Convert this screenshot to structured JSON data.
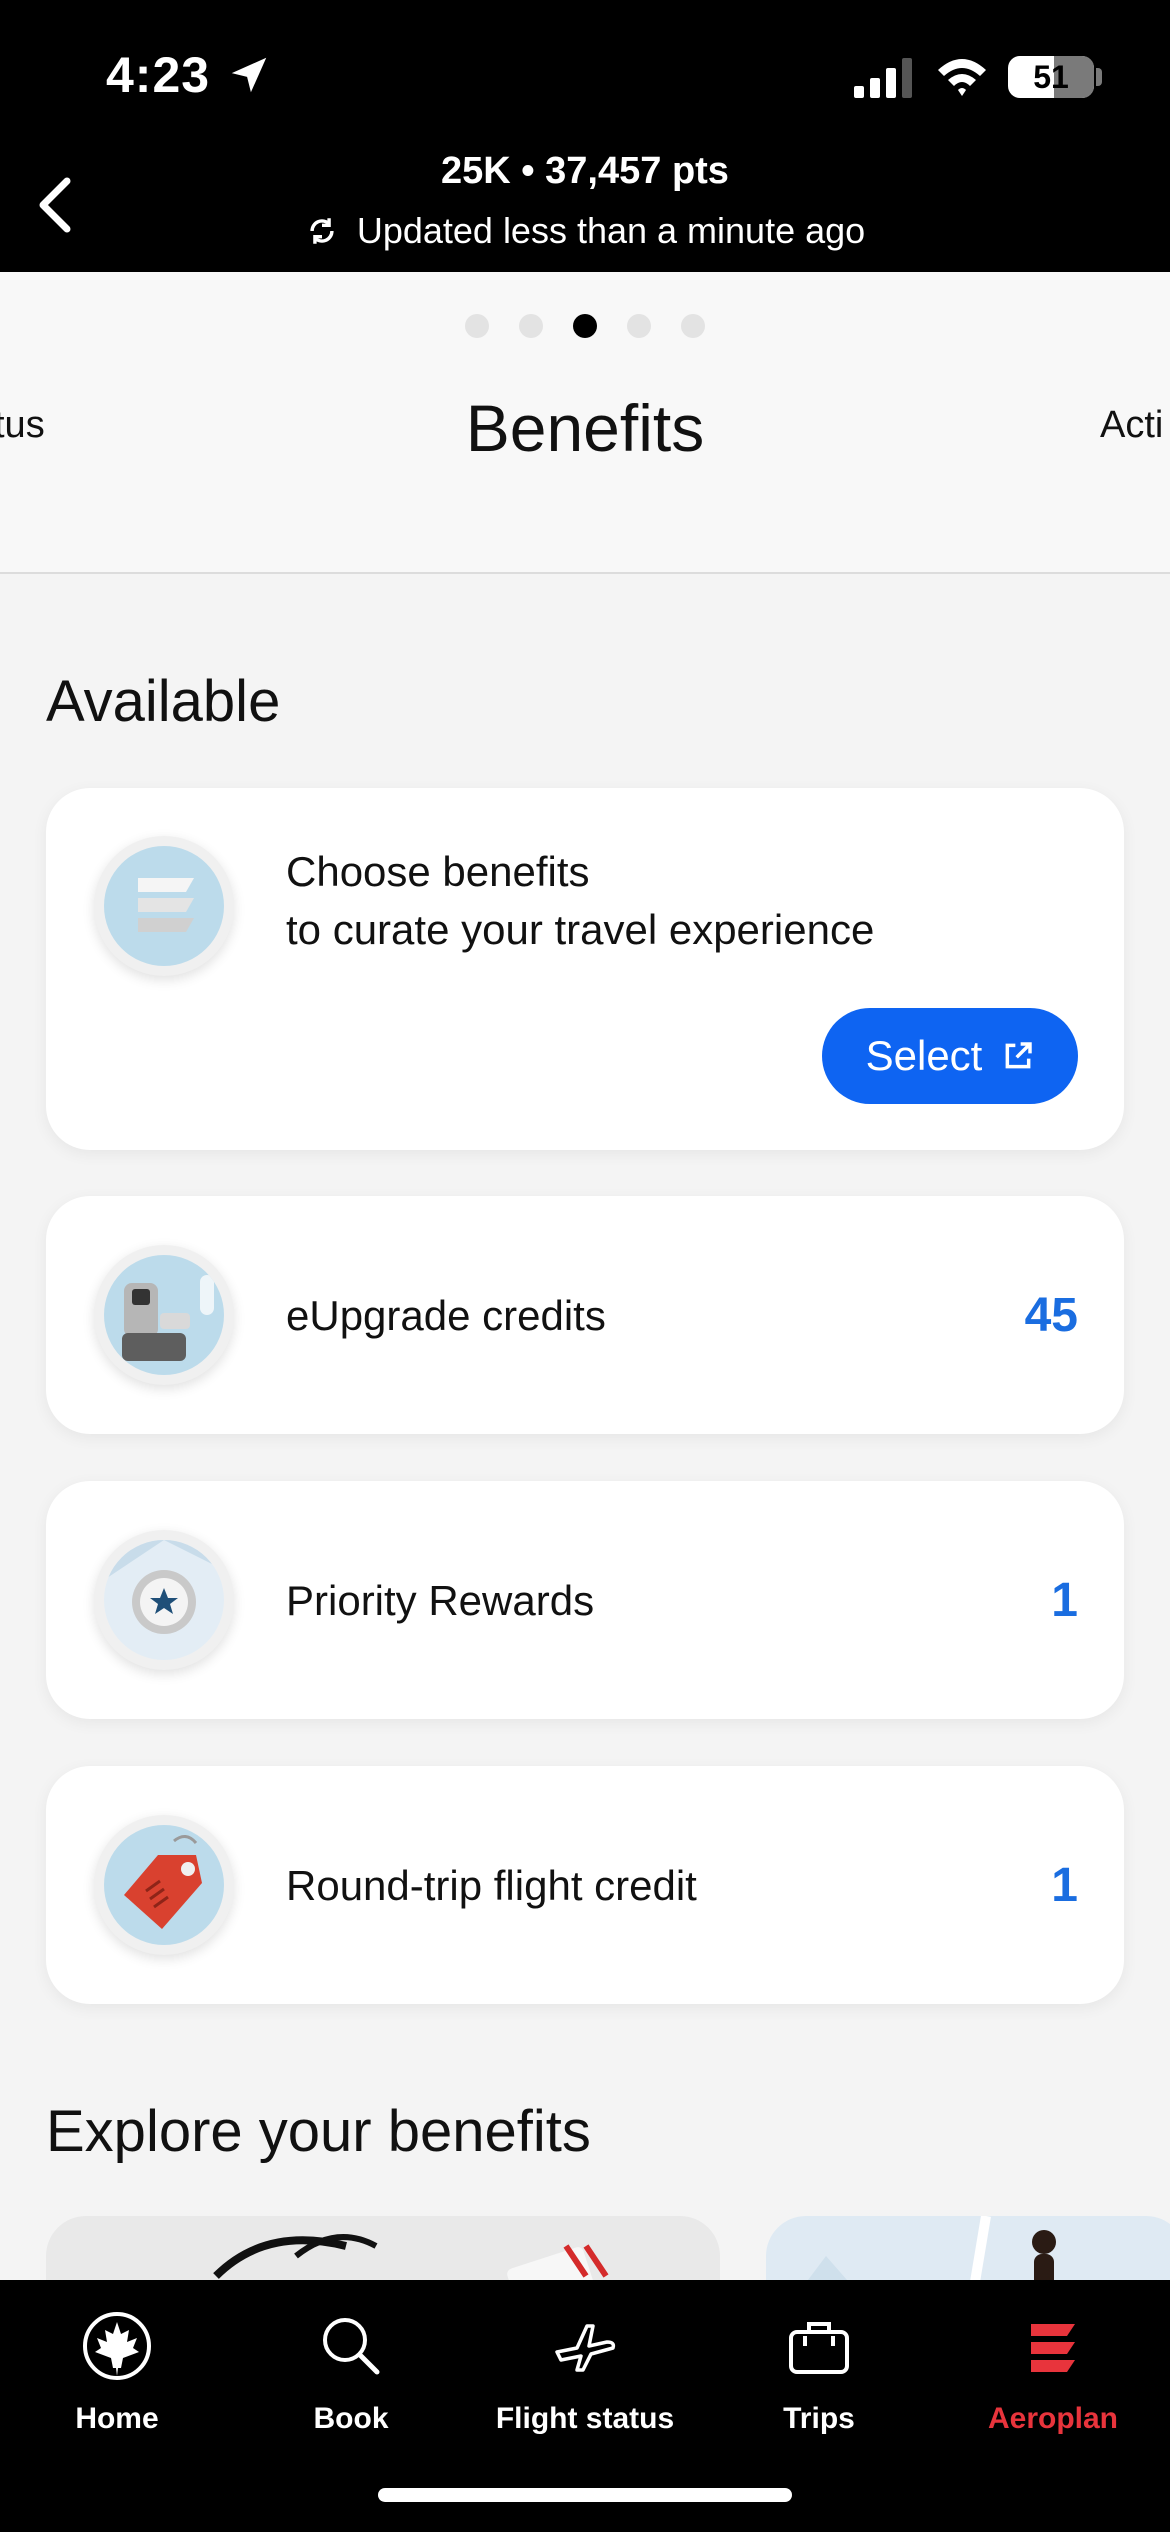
{
  "status_bar": {
    "time": "4:23",
    "battery": "51"
  },
  "header": {
    "tier_points": "25K • 37,457 pts",
    "updated": "Updated less than a minute ago"
  },
  "carousel": {
    "title": "Benefits",
    "prev_label": "tus",
    "next_label": "Acti",
    "active_index": 2,
    "total_pages": 5
  },
  "available": {
    "title": "Available",
    "choose": {
      "title": "Choose benefits",
      "subtitle": "to curate your travel experience",
      "button": "Select"
    },
    "items": [
      {
        "label": "eUpgrade credits",
        "value": "45",
        "icon": "seat-icon"
      },
      {
        "label": "Priority Rewards",
        "value": "1",
        "icon": "star-medal-icon"
      },
      {
        "label": "Round-trip flight credit",
        "value": "1",
        "icon": "tag-icon"
      }
    ]
  },
  "explore": {
    "title": "Explore your benefits"
  },
  "tabbar": {
    "tabs": [
      {
        "label": "Home",
        "icon": "maple-leaf-icon"
      },
      {
        "label": "Book",
        "icon": "search-icon"
      },
      {
        "label": "Flight status",
        "icon": "plane-icon"
      },
      {
        "label": "Trips",
        "icon": "suitcase-icon"
      },
      {
        "label": "Aeroplan",
        "icon": "aeroplan-icon",
        "active": true
      }
    ]
  },
  "colors": {
    "accent_blue": "#0e64f2",
    "value_blue": "#1a6de0",
    "active_red": "#e8343c"
  }
}
